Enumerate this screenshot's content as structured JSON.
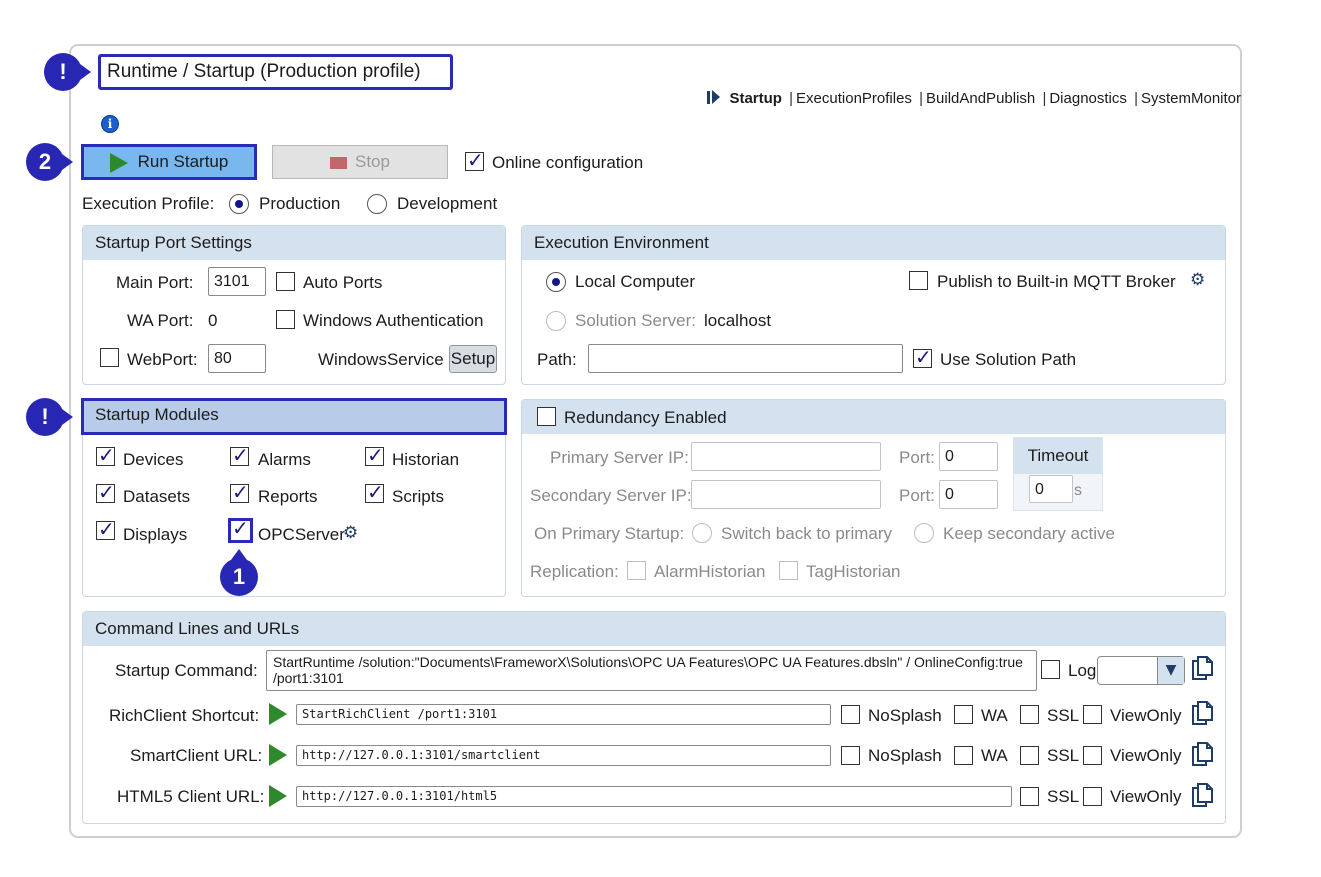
{
  "title": "Runtime / Startup (Production profile)",
  "callouts": {
    "title": "!",
    "run": "2",
    "modules": "!",
    "opc": "1"
  },
  "breadcrumb": {
    "current": "Startup",
    "items": [
      "ExecutionProfiles",
      "BuildAndPublish",
      "Diagnostics",
      "SystemMonitor"
    ],
    "separator": "|"
  },
  "info_icon": "i",
  "toolbar": {
    "run_label": "Run Startup",
    "stop_label": "Stop",
    "online_label": "Online configuration",
    "online_checked": true
  },
  "profile": {
    "label": "Execution Profile:",
    "options": [
      "Production",
      "Development"
    ],
    "selected": "Production"
  },
  "port_settings": {
    "title": "Startup Port Settings",
    "main_port_label": "Main Port:",
    "main_port_value": "3101",
    "auto_ports_label": "Auto Ports",
    "wa_port_label": "WA Port:",
    "wa_port_value": "0",
    "windows_auth_label": "Windows Authentication",
    "webport_label": "WebPort:",
    "webport_value": "80",
    "winservice_label": "WindowsService",
    "setup_label": "Setup"
  },
  "exec_env": {
    "title": "Execution Environment",
    "local_label": "Local Computer",
    "server_label": "Solution Server:",
    "server_value": "localhost",
    "mqtt_label": "Publish to Built-in MQTT Broker",
    "path_label": "Path:",
    "path_value": "",
    "use_solution_path_label": "Use Solution Path"
  },
  "modules": {
    "title": "Startup Modules",
    "items": [
      "Devices",
      "Alarms",
      "Historian",
      "Datasets",
      "Reports",
      "Scripts",
      "Displays",
      "OPCServer"
    ]
  },
  "redundancy": {
    "title": "Redundancy Enabled",
    "primary_ip_label": "Primary Server IP:",
    "secondary_ip_label": "Secondary Server IP:",
    "port_label": "Port:",
    "primary_port": "0",
    "secondary_port": "0",
    "timeout_label": "Timeout",
    "timeout_value": "0",
    "timeout_unit": "s",
    "on_primary_label": "On Primary Startup:",
    "switch_back_label": "Switch back to primary",
    "keep_secondary_label": "Keep secondary active",
    "replication_label": "Replication:",
    "alarm_hist_label": "AlarmHistorian",
    "tag_hist_label": "TagHistorian"
  },
  "commands": {
    "title": "Command Lines and URLs",
    "startup_label": "Startup Command:",
    "startup_value": "StartRuntime /solution:\"Documents\\FrameworX\\Solutions\\OPC UA Features\\OPC UA Features.dbsln\" / OnlineConfig:true /port1:3101",
    "log_label": "Log",
    "rich_label": "RichClient Shortcut:",
    "rich_value": "StartRichClient  /port1:3101",
    "smart_label": "SmartClient URL:",
    "smart_value": "http://127.0.0.1:3101/smartclient",
    "html5_label": "HTML5 Client URL:",
    "html5_value": "http://127.0.0.1:3101/html5",
    "nosplash_label": "NoSplash",
    "wa_label": "WA",
    "ssl_label": "SSL",
    "viewonly_label": "ViewOnly"
  },
  "colors": {
    "callout": "#2727b3",
    "run_button": "#79b8ee",
    "panel_header": "#d4e2ef",
    "selected_header": "#b8cbe9"
  }
}
